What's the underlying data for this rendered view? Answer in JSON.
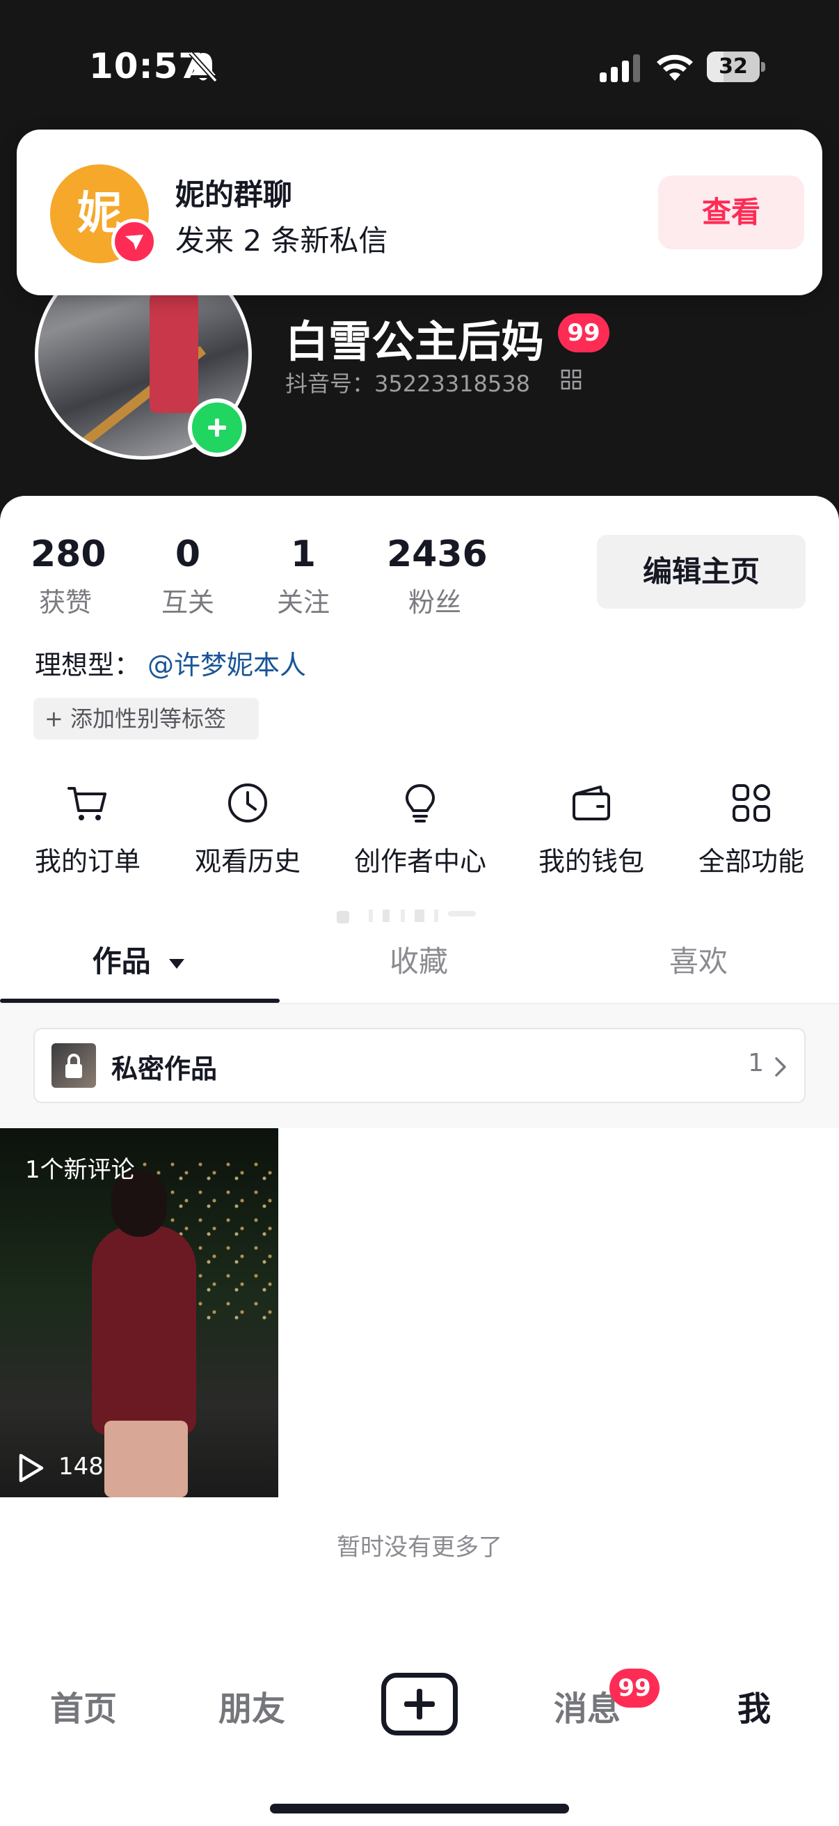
{
  "status_bar": {
    "time": "10:57",
    "battery_level": "32",
    "battery_fraction": 0.32
  },
  "notification": {
    "avatar_char": "妮",
    "title": "妮的群聊",
    "body": "发来 2 条新私信",
    "action_label": "查看"
  },
  "profile": {
    "name": "白雪公主后妈",
    "name_badge": "99",
    "douyin_id": "抖音号：35223318538"
  },
  "stats": [
    {
      "value": "280",
      "label": "获赞"
    },
    {
      "value": "0",
      "label": "互关"
    },
    {
      "value": "1",
      "label": "关注"
    },
    {
      "value": "2436",
      "label": "粉丝"
    }
  ],
  "edit_profile_label": "编辑主页",
  "ideal": {
    "label": "理想型：",
    "link": "@许梦妮本人"
  },
  "tag_chip_label": "+ 添加性别等标签",
  "shortcuts": [
    {
      "label": "我的订单",
      "icon": "cart-icon"
    },
    {
      "label": "观看历史",
      "icon": "clock-icon"
    },
    {
      "label": "创作者中心",
      "icon": "lightbulb-icon"
    },
    {
      "label": "我的钱包",
      "icon": "wallet-icon"
    },
    {
      "label": "全部功能",
      "icon": "grid-icon"
    }
  ],
  "tabs": [
    {
      "label": "作品"
    },
    {
      "label": "收藏"
    },
    {
      "label": "喜欢"
    }
  ],
  "private_works": {
    "label": "私密作品",
    "count": "1"
  },
  "video": {
    "comment_badge": "1个新评论",
    "play_count": "148"
  },
  "no_more_text": "暂时没有更多了",
  "bottom_nav": {
    "home": "首页",
    "friends": "朋友",
    "messages": "消息",
    "messages_badge": "99",
    "me": "我"
  },
  "colors": {
    "accent": "#fe2c55",
    "link": "#1a5596",
    "header_bg": "#161616",
    "follow_green": "#20d560"
  }
}
